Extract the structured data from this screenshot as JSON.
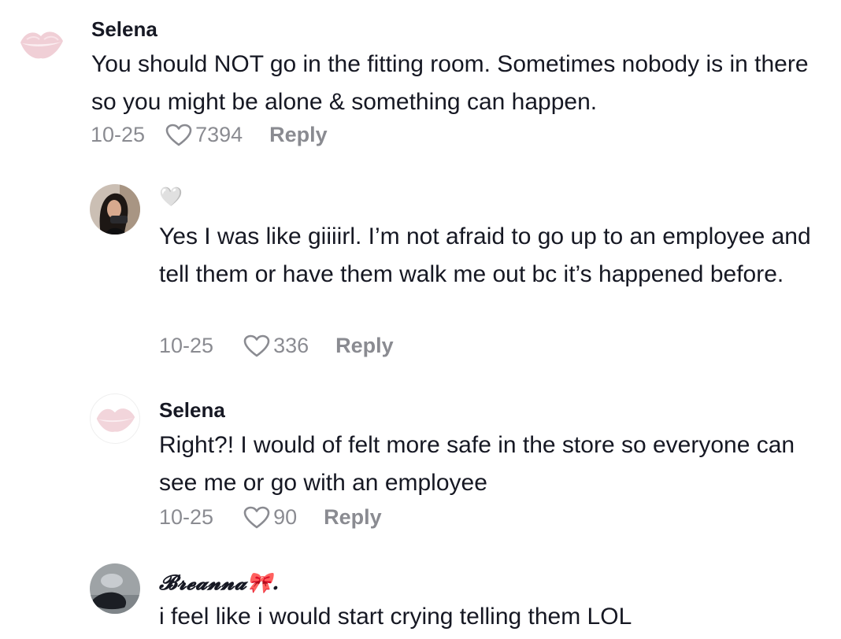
{
  "comments": [
    {
      "username": "Selena",
      "text": "You should NOT go in the fitting room. Sometimes nobody is in there so you might be alone & something can happen.",
      "date": "10-25",
      "likes": "7394",
      "reply_label": "Reply",
      "avatar": "lips-icon"
    },
    {
      "username": "🤍",
      "text": "Yes I was like giiiirl. I’m not afraid to go up to an employee and tell them or have them walk me out bc it’s happened before.",
      "date": "10-25",
      "likes": "336",
      "reply_label": "Reply",
      "avatar": "user-photo"
    },
    {
      "username": "Selena",
      "text": "Right?! I would of felt more safe in the store so everyone can see me or go with an employee",
      "date": "10-25",
      "likes": "90",
      "reply_label": "Reply",
      "avatar": "lips-icon"
    },
    {
      "username": "𝓑𝓻𝓮𝓪𝓷𝓷𝓪🎀.",
      "text": "i feel like i would start crying telling them LOL",
      "avatar": "user-photo"
    }
  ]
}
